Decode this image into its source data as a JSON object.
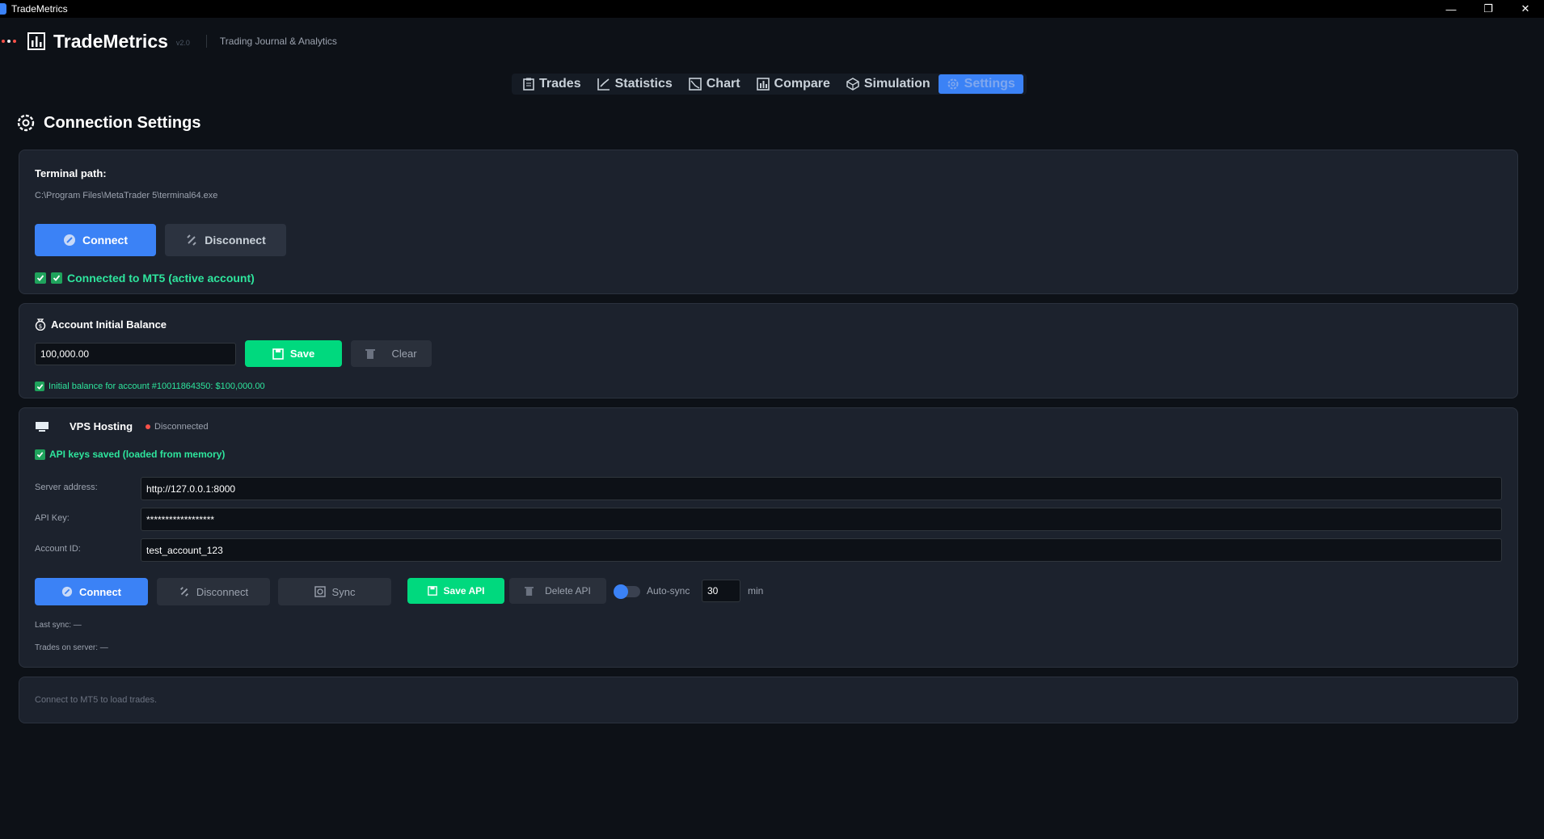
{
  "window": {
    "title": "TradeMetrics",
    "minimize": "—",
    "restore": "❐",
    "close": "✕"
  },
  "app": {
    "name": "TradeMetrics",
    "version": "v2.0",
    "subtitle": "Trading Journal & Analytics"
  },
  "tabs": [
    {
      "label": "Trades",
      "icon": "clipboard-icon"
    },
    {
      "label": "Statistics",
      "icon": "chart-check-icon"
    },
    {
      "label": "Chart",
      "icon": "chart-line-icon"
    },
    {
      "label": "Compare",
      "icon": "bar-chart-icon"
    },
    {
      "label": "Simulation",
      "icon": "cube-icon"
    },
    {
      "label": "Settings",
      "icon": "gear-icon",
      "active": true
    }
  ],
  "page": {
    "title": "Connection Settings"
  },
  "terminal": {
    "label": "Terminal path:",
    "path": "C:\\Program Files\\MetaTrader 5\\terminal64.exe",
    "connect": "Connect",
    "disconnect": "Disconnect",
    "status": "Connected to MT5 (active account)"
  },
  "balance": {
    "title": "Account Initial Balance",
    "value": "100,000.00",
    "save": "Save",
    "clear": "Clear",
    "status": "Initial balance for account #10011864350: $100,000.00"
  },
  "vps": {
    "title": "VPS Hosting",
    "status": "Disconnected",
    "api_status": "API keys saved (loaded from memory)",
    "server_label": "Server address:",
    "server_value": "http://127.0.0.1:8000",
    "apikey_label": "API Key:",
    "apikey_value": "******************",
    "account_label": "Account ID:",
    "account_value": "test_account_123",
    "connect": "Connect",
    "disconnect": "Disconnect",
    "sync": "Sync",
    "save_api": "Save API",
    "delete_api": "Delete API",
    "autosync": "Auto-sync",
    "interval": "30",
    "interval_unit": "min",
    "last_sync": "Last sync: —",
    "trades_on_server": "Trades on server: —"
  },
  "footer": {
    "message": "Connect to MT5 to load trades."
  },
  "colors": {
    "accent": "#3b82f6",
    "success": "#00d97e",
    "danger": "#f85149",
    "bg": "#0d1117",
    "card": "#1c222d"
  }
}
